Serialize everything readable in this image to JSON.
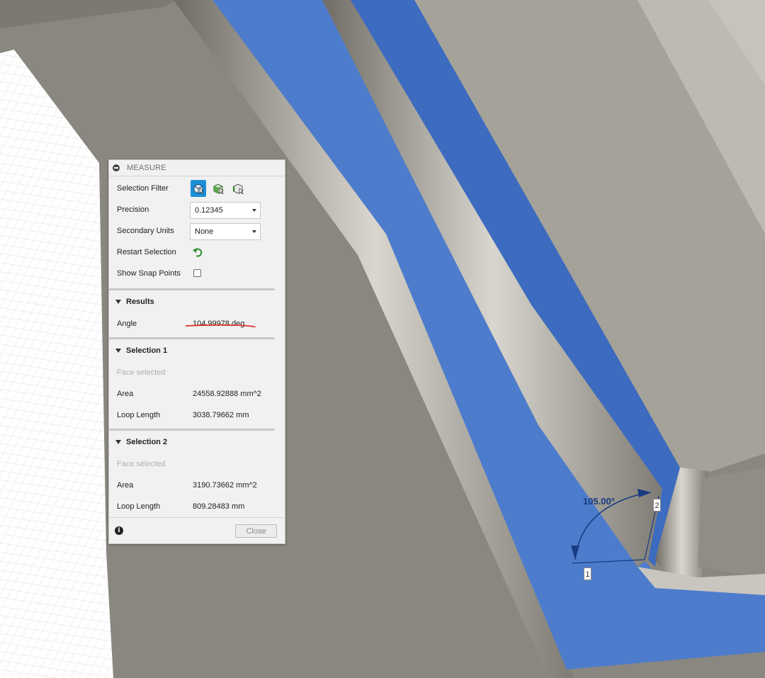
{
  "measure_panel": {
    "title": "MEASURE",
    "selection_filter": {
      "label": "Selection Filter",
      "icons": [
        "body-select-icon",
        "face-select-icon",
        "edge-select-icon"
      ]
    },
    "precision": {
      "label": "Precision",
      "value": "0.12345"
    },
    "secondary_units": {
      "label": "Secondary Units",
      "value": "None"
    },
    "restart_selection": {
      "label": "Restart Selection",
      "icon": "restart-arrow-icon"
    },
    "show_snap_points": {
      "label": "Show Snap Points",
      "checked": false
    },
    "results": {
      "header": "Results",
      "angle_label": "Angle",
      "angle_value": "104.99978 deg"
    },
    "selection1": {
      "header": "Selection 1",
      "status": "Face selected",
      "area_label": "Area",
      "area_value": "24558.92888 mm^2",
      "loop_label": "Loop Length",
      "loop_value": "3038.79662 mm"
    },
    "selection2": {
      "header": "Selection 2",
      "status": "Face selected",
      "area_label": "Area",
      "area_value": "3190.73662 mm^2",
      "loop_label": "Loop Length",
      "loop_value": "809.28483 mm"
    },
    "close_label": "Close"
  },
  "viewport": {
    "angle_label": "105.00°",
    "marker1": "1",
    "marker2": "2"
  },
  "colors": {
    "accent": "#1e90d8",
    "selected_face": "#4d7ccc",
    "model_grey": "#a09d94",
    "annotation_red": "#d8352a"
  }
}
